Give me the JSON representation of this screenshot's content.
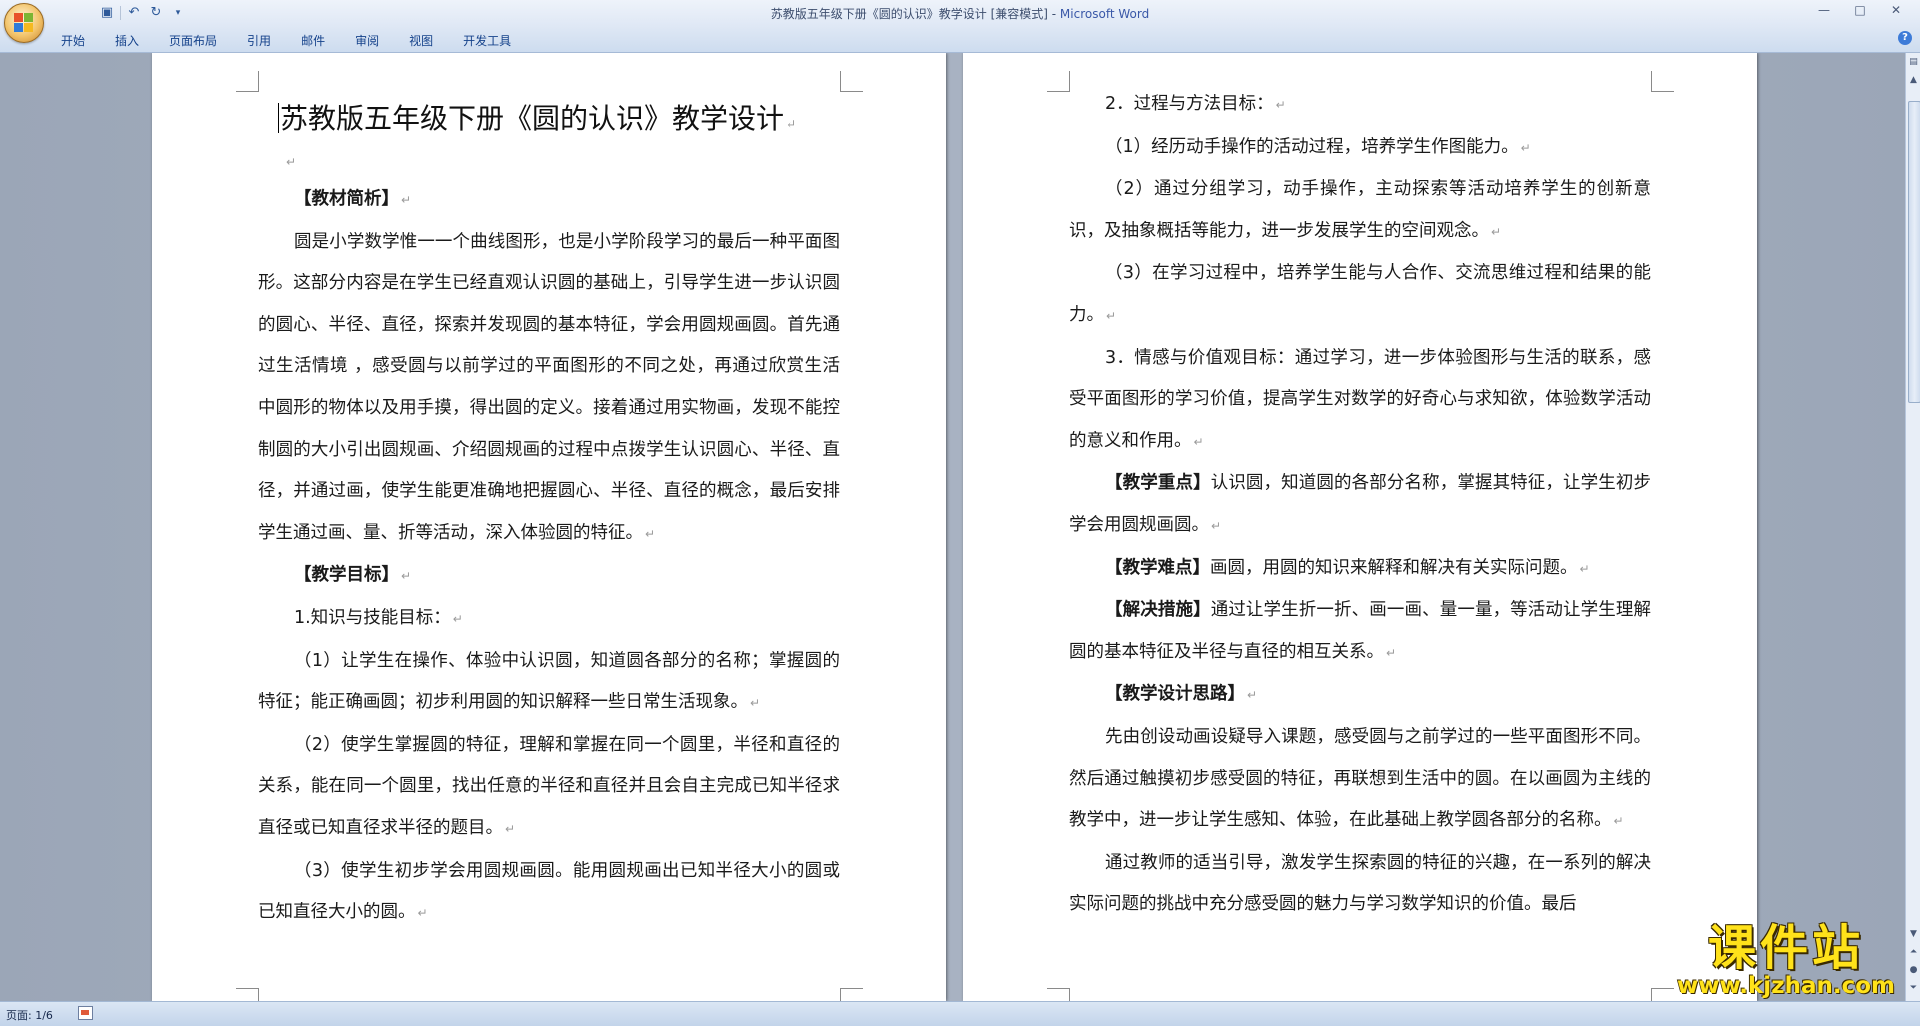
{
  "window": {
    "title": "苏教版五年级下册《圆的认识》教学设计 [兼容模式] - ",
    "app_name": "Microsoft Word",
    "controls": [
      "—",
      "□",
      "✕"
    ]
  },
  "quick_access": [
    "save-icon",
    "undo-icon",
    "redo-icon",
    "customize-icon"
  ],
  "ribbon": {
    "tabs": [
      "开始",
      "插入",
      "页面布局",
      "引用",
      "邮件",
      "审阅",
      "视图",
      "开发工具"
    ],
    "help": "?"
  },
  "status_bar": {
    "page": "页面: 1/6"
  },
  "document": {
    "title": "苏教版五年级下册《圆的认识》教学设计",
    "paragraph_mark": "↵",
    "left_page": {
      "sec1_heading": "【教材简析】",
      "sec1_body": "圆是小学数学惟一一个曲线图形，也是小学阶段学习的最后一种平面图形。这部分内容是在学生已经直观认识圆的基础上，引导学生进一步认识圆的圆心、半径、直径，探索并发现圆的基本特征，学会用圆规画圆。首先通过生活情境 ，感受圆与以前学过的平面图形的不同之处，再通过欣赏生活中圆形的物体以及用手摸，得出圆的定义。接着通过用实物画，发现不能控制圆的大小引出圆规画、介绍圆规画的过程中点拨学生认识圆心、半径、直径，并通过画，使学生能更准确地把握圆心、半径、直径的概念，最后安排学生通过画、量、折等活动，深入体验圆的特征。",
      "sec2_heading": "【教学目标】",
      "goal1_heading": "1.知识与技能目标：",
      "goal1_item1": "（1）让学生在操作、体验中认识圆，知道圆各部分的名称；掌握圆的特征；能正确画圆；初步利用圆的知识解释一些日常生活现象。",
      "goal1_item2": "（2）使学生掌握圆的特征，理解和掌握在同一个圆里，半径和直径的关系，能在同一个圆里，找出任意的半径和直径并且会自主完成已知半径求直径或已知直径求半径的题目。",
      "goal1_item3": "（3）使学生初步学会用圆规画圆。能用圆规画出已知半径大小的圆或已知直径大小的圆。"
    },
    "right_page": {
      "goal2_heading": "2．过程与方法目标：",
      "goal2_item1": "（1）经历动手操作的活动过程，培养学生作图能力。",
      "goal2_item2": "（2）通过分组学习，动手操作，主动探索等活动培养学生的创新意识，及抽象概括等能力，进一步发展学生的空间观念。",
      "goal2_item3": "（3）在学习过程中，培养学生能与人合作、交流思维过程和结果的能力。",
      "goal3": "3．情感与价值观目标：通过学习，进一步体验图形与生活的联系，感受平面图形的学习价值，提高学生对数学的好奇心与求知欲，体验数学活动的意义和作用。",
      "key_label": "【教学重点】",
      "key_text": "认识圆，知道圆的各部分名称，掌握其特征，让学生初步学会用圆规画圆。",
      "diff_label": "【教学难点】",
      "diff_text": "画圆，用圆的知识来解释和解决有关实际问题。",
      "measure_label": "【解决措施】",
      "measure_text": "通过让学生折一折、画一画、量一量，等活动让学生理解圆的基本特征及半径与直径的相互关系。",
      "idea_heading": "【教学设计思路】",
      "idea_p1": "先由创设动画设疑导入课题，感受圆与之前学过的一些平面图形不同。然后通过触摸初步感受圆的特征，再联想到生活中的圆。在以画圆为主线的教学中，进一步让学生感知、体验，在此基础上教学圆各部分的名称。",
      "idea_p2": "通过教师的适当引导，激发学生探索圆的特征的兴趣，在一系列的解决实际问题的挑战中充分感受圆的魅力与学习数学知识的价值。最后"
    }
  },
  "watermark": {
    "title": "课件站",
    "url": "www.kjzhan.com"
  }
}
